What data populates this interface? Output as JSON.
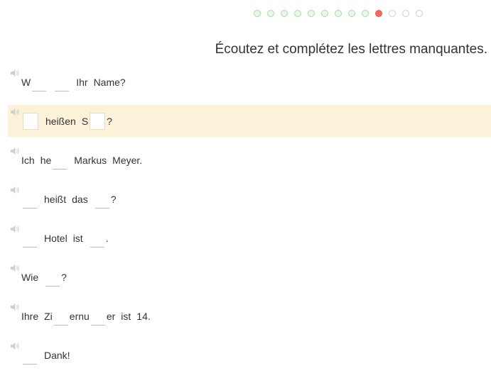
{
  "progress": [
    "done",
    "done",
    "done",
    "done",
    "done",
    "done",
    "done",
    "done",
    "done",
    "current",
    "todo",
    "todo",
    "todo"
  ],
  "instruction": "Écoutez et complétez les lettres manquantes.",
  "sentences": [
    {
      "active": false,
      "tokens": [
        {
          "t": "W"
        },
        {
          "b": 1
        },
        {
          "s": 1
        },
        {
          "b": 1
        },
        {
          "s": 1
        },
        {
          "t": "Ihr"
        },
        {
          "s": 1
        },
        {
          "t": "Name?"
        }
      ]
    },
    {
      "active": true,
      "tokens": [
        {
          "b": 1
        },
        {
          "s": 1
        },
        {
          "t": "heißen"
        },
        {
          "s": 1
        },
        {
          "t": "S"
        },
        {
          "b": 1
        },
        {
          "t": "?"
        }
      ]
    },
    {
      "active": false,
      "tokens": [
        {
          "t": "Ich"
        },
        {
          "s": 1
        },
        {
          "t": "he"
        },
        {
          "b": 1
        },
        {
          "s": 1
        },
        {
          "t": "Markus"
        },
        {
          "s": 1
        },
        {
          "t": "Meyer."
        }
      ]
    },
    {
      "active": false,
      "tokens": [
        {
          "b": 1
        },
        {
          "s": 1
        },
        {
          "t": "heißt"
        },
        {
          "s": 1
        },
        {
          "t": "das"
        },
        {
          "s": 1
        },
        {
          "b": 1
        },
        {
          "t": "?"
        }
      ]
    },
    {
      "active": false,
      "tokens": [
        {
          "b": 1
        },
        {
          "s": 1
        },
        {
          "t": "Hotel"
        },
        {
          "s": 1
        },
        {
          "t": "ist"
        },
        {
          "s": 1
        },
        {
          "b": 1
        },
        {
          "t": "."
        }
      ]
    },
    {
      "active": false,
      "tokens": [
        {
          "t": "Wie"
        },
        {
          "s": 1
        },
        {
          "b": 1
        },
        {
          "t": "?"
        }
      ]
    },
    {
      "active": false,
      "tokens": [
        {
          "t": "Ihre"
        },
        {
          "s": 1
        },
        {
          "t": "Zi"
        },
        {
          "b": 1
        },
        {
          "t": "ernu"
        },
        {
          "b": 1
        },
        {
          "t": "er"
        },
        {
          "s": 1
        },
        {
          "t": "ist"
        },
        {
          "s": 1
        },
        {
          "t": "14."
        }
      ]
    },
    {
      "active": false,
      "tokens": [
        {
          "b": 1
        },
        {
          "s": 1
        },
        {
          "t": "Dank!"
        }
      ]
    }
  ],
  "icons": {
    "speaker": "speaker-icon"
  }
}
